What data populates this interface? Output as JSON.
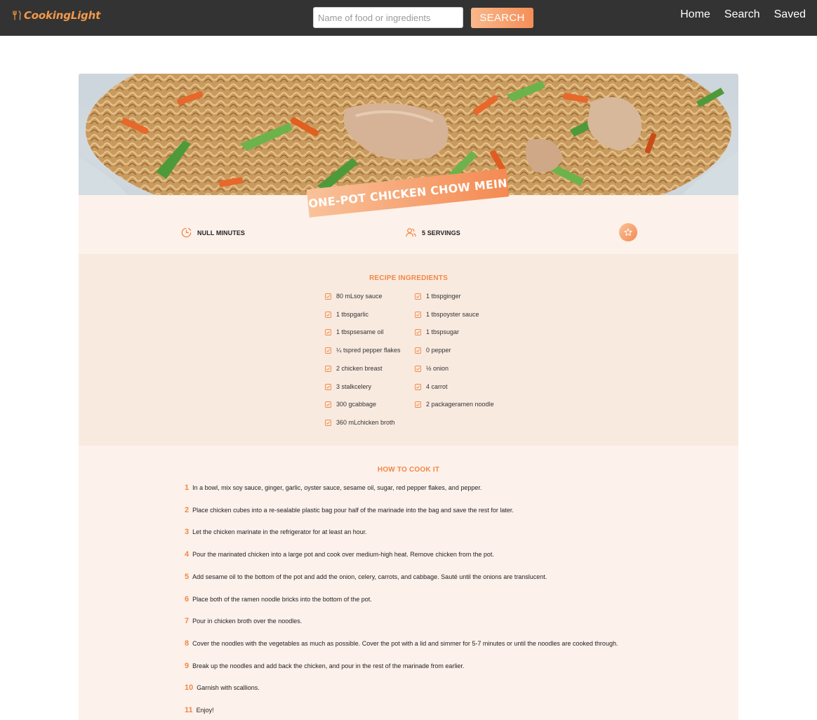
{
  "navbar": {
    "logo_text": "CookingLight",
    "search_placeholder": "Name of food or ingredients",
    "search_value": "",
    "search_button": "SEARCH",
    "links": [
      "Home",
      "Search",
      "Saved"
    ]
  },
  "recipe": {
    "title": "ONE-POT CHICKEN CHOW MEIN",
    "duration": "NULL MINUTES",
    "servings": "5 SERVINGS",
    "bookmark_icon": "star-icon",
    "ingredients_title": "RECIPE INGREDIENTS",
    "ingredients": [
      "80 mLsoy sauce",
      "1 tbspginger",
      "1 tbspgarlic",
      "1 tbspoyster sauce",
      "1 tbspsesame oil",
      "1 tbspsugar",
      "¼ tspred pepper flakes",
      "0 pepper",
      "2 chicken breast",
      "½ onion",
      "3 stalkcelery",
      "4 carrot",
      "300 gcabbage",
      "2 packageramen noodle",
      "360 mLchicken broth"
    ],
    "directions_title": "HOW TO COOK IT",
    "steps": [
      {
        "num": "1",
        "text": "In a bowl, mix soy sauce, ginger, garlic, oyster sauce, sesame oil, sugar, red pepper flakes, and pepper."
      },
      {
        "num": "2",
        "text": "Place chicken cubes into a re-sealable plastic bag pour half of the marinade into the bag and save the rest for later."
      },
      {
        "num": "3",
        "text": "Let the chicken marinate in the refrigerator for at least an hour."
      },
      {
        "num": "4",
        "text": "Pour the marinated chicken into a large pot and cook over medium-high heat. Remove chicken from the pot."
      },
      {
        "num": "5",
        "text": "Add sesame oil to the bottom of the pot and add the onion, celery, carrots, and cabbage. Sauté until the onions are translucent."
      },
      {
        "num": "6",
        "text": "Place both of the ramen noodle bricks into the bottom of the pot."
      },
      {
        "num": "7",
        "text": "Pour in chicken broth over the noodles."
      },
      {
        "num": "8",
        "text": "Cover the noodles with the vegetables as much as possible. Cover the pot with a lid and simmer for 5-7 minutes or until the noodles are cooked through."
      },
      {
        "num": "9",
        "text": "Break up the noodles and add back the chicken, and pour in the rest of the marinade from earlier."
      },
      {
        "num": "10",
        "text": "Garnish with scallions."
      },
      {
        "num": "11",
        "text": "Enjoy!"
      }
    ]
  },
  "colors": {
    "navbar_bg": "#333333",
    "accent": "#f38744",
    "details_bg": "#fdf1eb",
    "ingredients_bg": "#f9eae0"
  }
}
